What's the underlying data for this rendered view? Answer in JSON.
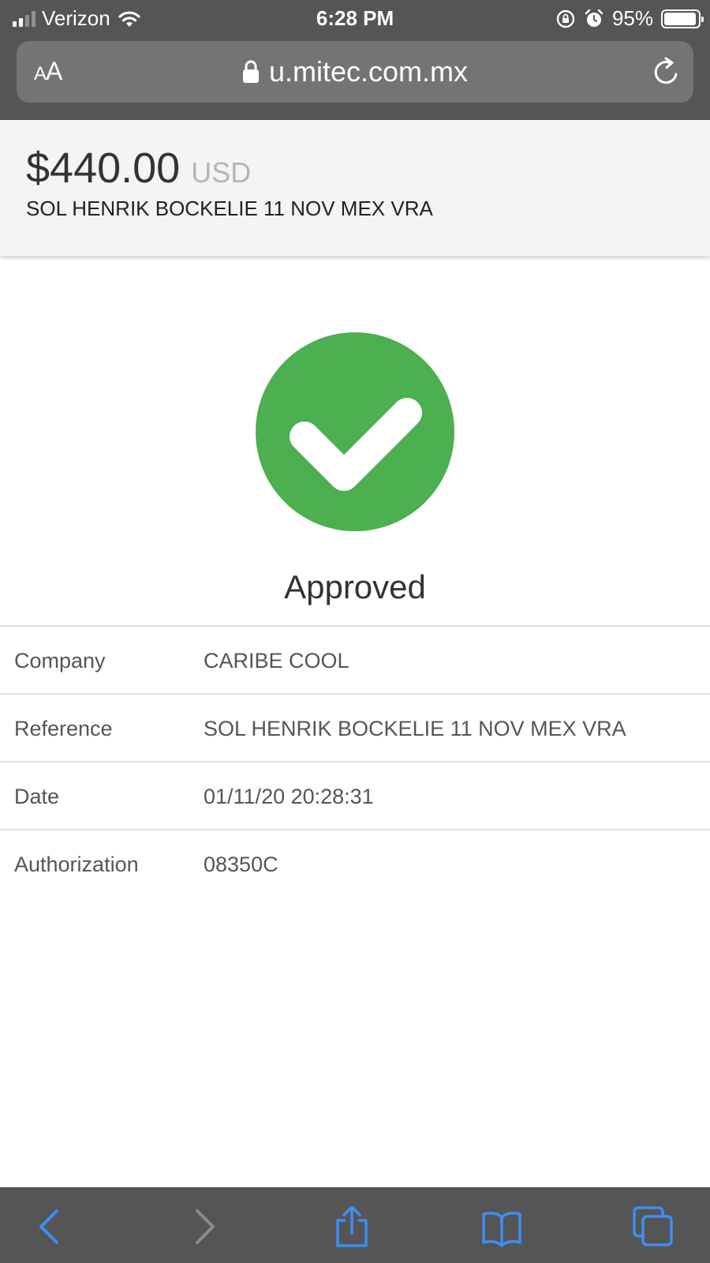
{
  "status_bar": {
    "carrier": "Verizon",
    "time": "6:28 PM",
    "battery": "95%",
    "battery_level": 0.95
  },
  "address_bar": {
    "text_size_label": "AA",
    "url": "u.mitec.com.mx"
  },
  "summary": {
    "amount": "$440.00",
    "currency": "USD",
    "reference": "SOL HENRIK BOCKELIE 11 NOV MEX VRA"
  },
  "result": {
    "status": "Approved",
    "status_color": "#4caf50"
  },
  "details": [
    {
      "label": "Company",
      "value": "CARIBE COOL"
    },
    {
      "label": "Reference",
      "value": "SOL HENRIK BOCKELIE 11 NOV MEX VRA"
    },
    {
      "label": "Date",
      "value": "01/11/20 20:28:31"
    },
    {
      "label": "Authorization",
      "value": "08350C"
    }
  ],
  "toolbar": {
    "icons": [
      "back-icon",
      "forward-icon",
      "share-icon",
      "bookmarks-icon",
      "tabs-icon"
    ],
    "accent": "#3d8ff2"
  }
}
